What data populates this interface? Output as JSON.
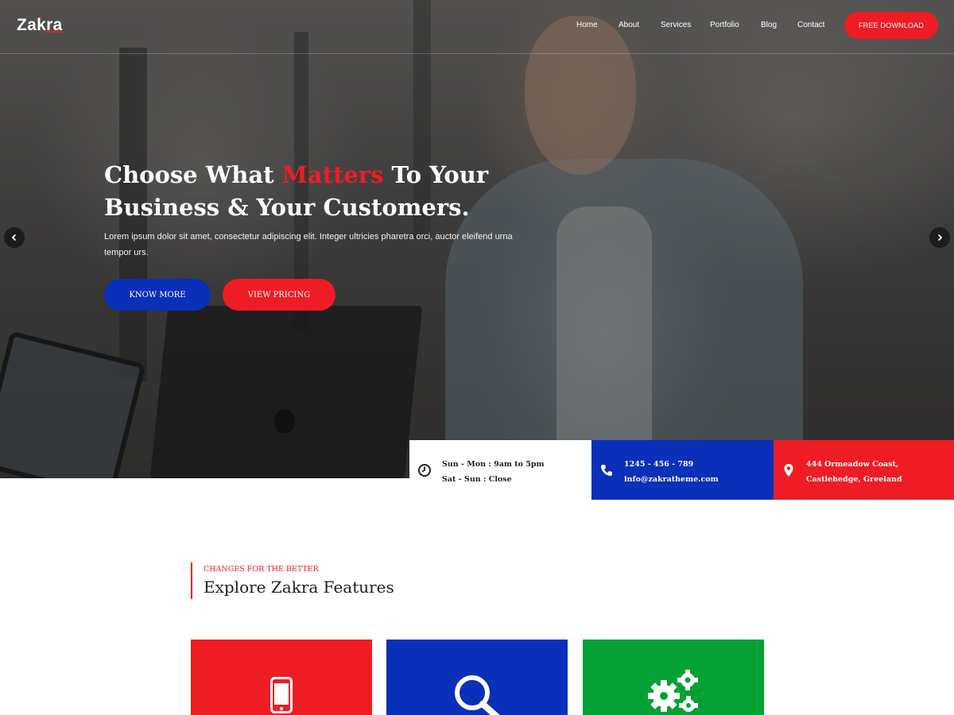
{
  "brand": {
    "name": "Zakra",
    "accent": "#ef1c26",
    "blue": "#0a2fb8",
    "green": "#05a135"
  },
  "nav": {
    "items": [
      "Home",
      "About",
      "Services",
      "Portfolio",
      "Blog",
      "Contact"
    ],
    "cta": "FREE DOWNLOAD"
  },
  "slider": {
    "prev_icon": "chevron-left-icon",
    "next_icon": "chevron-right-icon"
  },
  "hero": {
    "title_part1": "Choose What ",
    "title_accent": "Matters",
    "title_part2": " To Your Business & Your Customers.",
    "description": "Lorem ipsum dolor sit amet, consectetur adipiscing elit. Integer ultricies pharetra orci, auctor eleifend urna tempor urs.",
    "btn_primary": "KNOW MORE",
    "btn_secondary": "VIEW PRICING"
  },
  "info": {
    "hours": {
      "icon": "clock-icon",
      "line1": "Sun - Mon : 9am to 5pm",
      "line2": "Sat - Sun : Close"
    },
    "contact": {
      "icon": "phone-icon",
      "line1": "1245 - 456 - 789",
      "line2": "info@zakratheme.com"
    },
    "address": {
      "icon": "map-pin-icon",
      "line1": "444 Ormeadow Coast,",
      "line2": "Castlehedge, Greeland"
    }
  },
  "features": {
    "kicker": "CHANGES FOR THE BETTER",
    "title": "Explore Zakra Features",
    "cards": [
      {
        "icon": "mobile-phone-icon",
        "color": "#ef1c26"
      },
      {
        "icon": "search-icon",
        "color": "#0a2fb8"
      },
      {
        "icon": "gears-icon",
        "color": "#05a135"
      }
    ]
  }
}
